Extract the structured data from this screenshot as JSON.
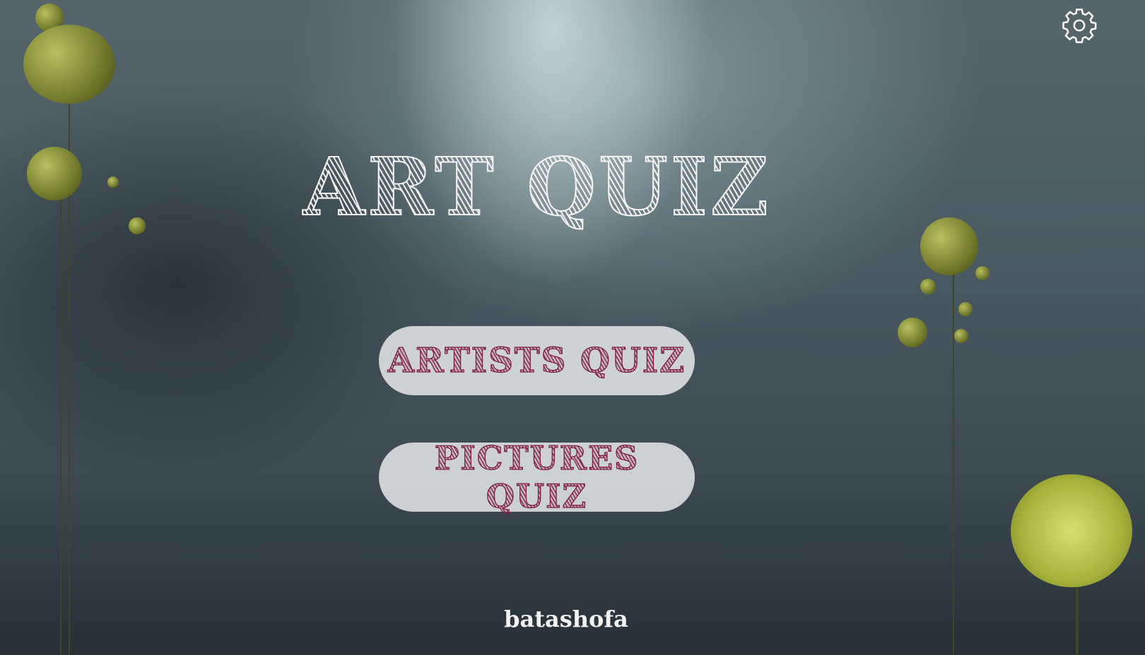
{
  "header": {
    "settings_icon": "gear-icon"
  },
  "title": "ART QUIZ",
  "menu": {
    "buttons": [
      {
        "label": "ARTISTS QUIZ"
      },
      {
        "label": "PICTURES QUIZ"
      }
    ]
  },
  "footer": {
    "author": "batashofa"
  },
  "colors": {
    "button_text": "#8b2a4f",
    "button_bg": "#e1e4e6",
    "title": "#f4f4f4"
  }
}
